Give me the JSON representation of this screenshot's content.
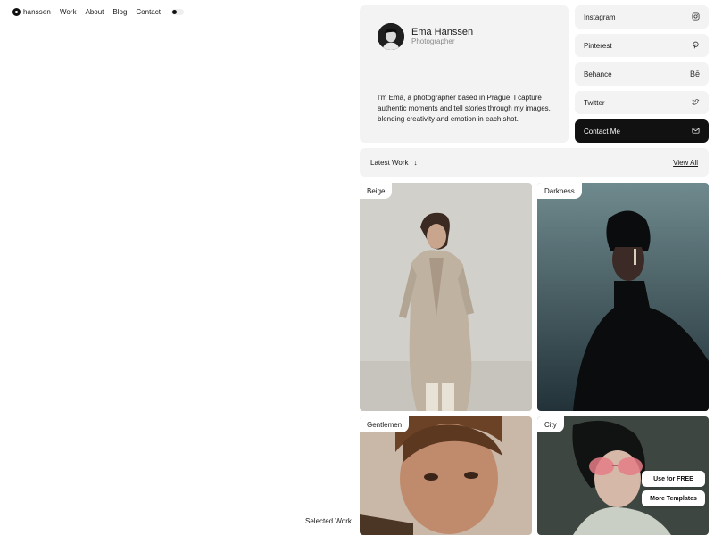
{
  "nav": {
    "brand": "hanssen",
    "links": [
      "Work",
      "About",
      "Blog",
      "Contact"
    ]
  },
  "footer_label": "Selected Work",
  "profile": {
    "name": "Ema Hanssen",
    "role": "Photographer",
    "bio": "I'm Ema, a photographer based in Prague. I capture authentic moments and tell stories through my images, blending creativity and emotion in each shot."
  },
  "social": [
    {
      "label": "Instagram",
      "icon": "instagram-icon",
      "glyph": "◎"
    },
    {
      "label": "Pinterest",
      "icon": "pinterest-icon",
      "glyph": "℗"
    },
    {
      "label": "Behance",
      "icon": "behance-icon",
      "glyph": "Bē"
    },
    {
      "label": "Twitter",
      "icon": "twitter-icon",
      "glyph": "🐦"
    },
    {
      "label": "Contact Me",
      "icon": "mail-icon",
      "glyph": "✉"
    }
  ],
  "latest": {
    "label": "Latest Work",
    "arrow": "↓",
    "view_all": "View All"
  },
  "gallery": [
    {
      "label": "Beige"
    },
    {
      "label": "Darkness"
    },
    {
      "label": "Gentlemen"
    },
    {
      "label": "City"
    }
  ],
  "promo": {
    "use_free": "Use for FREE",
    "more_templates": "More Templates"
  },
  "colors": {
    "card_bg": "#f3f3f3",
    "dark_button": "#111111",
    "text": "#1a1a1a"
  }
}
